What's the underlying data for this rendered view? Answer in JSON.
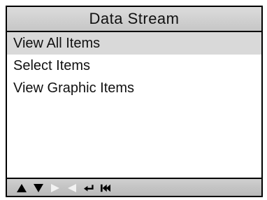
{
  "screen": {
    "title": "Data Stream",
    "menu": {
      "items": [
        {
          "label": "View All Items",
          "selected": true
        },
        {
          "label": "Select Items",
          "selected": false
        },
        {
          "label": "View Graphic Items",
          "selected": false
        }
      ]
    },
    "footer": {
      "icons": [
        {
          "name": "up-arrow-icon",
          "enabled": true
        },
        {
          "name": "down-arrow-icon",
          "enabled": true
        },
        {
          "name": "right-arrow-icon",
          "enabled": false
        },
        {
          "name": "left-arrow-icon",
          "enabled": false
        },
        {
          "name": "enter-icon",
          "enabled": true
        },
        {
          "name": "skip-back-icon",
          "enabled": true
        }
      ]
    }
  },
  "colors": {
    "title_bar": "#c6c6c6",
    "selected_row": "#d9d9d9",
    "footer_bar": "#b9b9b9",
    "icon_active": "#000000",
    "icon_disabled": "#f2f2f2"
  }
}
